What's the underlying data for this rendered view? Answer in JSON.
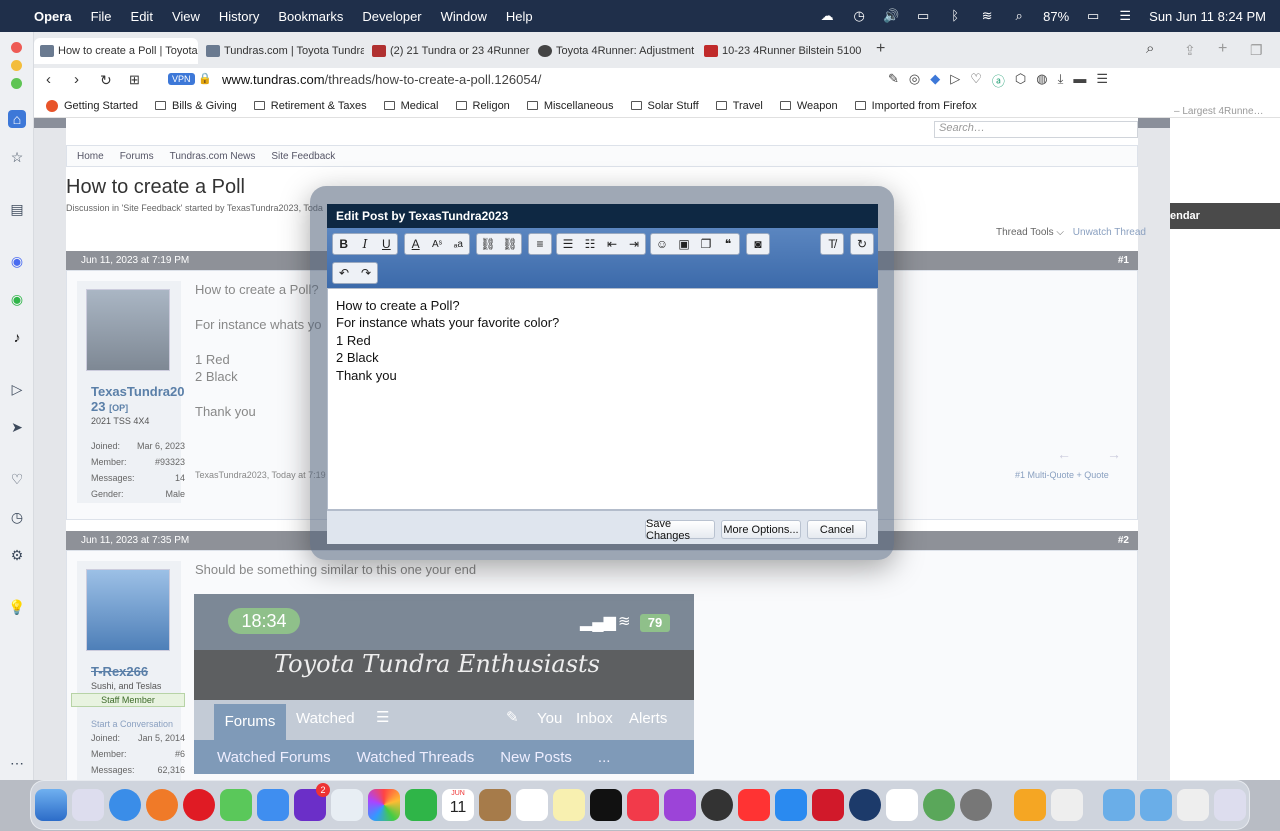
{
  "menubar": {
    "app": "Opera",
    "items": [
      "File",
      "Edit",
      "View",
      "History",
      "Bookmarks",
      "Developer",
      "Window",
      "Help"
    ],
    "battery": "87%",
    "datetime": "Sun Jun 11  8:24 PM"
  },
  "tabs": [
    {
      "label": "How to create a Poll | Toyota Tu",
      "active": true
    },
    {
      "label": "Tundras.com | Toyota Tundra Fo",
      "active": false
    },
    {
      "label": "(2) 21 Tundra or 23 4Runner Vo",
      "active": false
    },
    {
      "label": "Toyota 4Runner: Adjustment - F",
      "active": false
    },
    {
      "label": "10-23 4Runner Bilstein 5100 C",
      "active": false
    }
  ],
  "address": {
    "vpn": "VPN",
    "host": "www.tundras.com",
    "path": "/threads/how-to-create-a-poll.126054/"
  },
  "bookmarks": [
    "Getting Started",
    "Bills & Giving",
    "Retirement & Taxes",
    "Medical",
    "Religon",
    "Miscellaneous",
    "Solar Stuff",
    "Travel",
    "Weapon",
    "Imported from Firefox"
  ],
  "right_pane": {
    "text": "– Largest 4Runne…",
    "bar": "endar"
  },
  "page": {
    "search_placeholder": "Search…",
    "breadcrumbs": [
      "Home",
      "Forums",
      "Tundras.com News",
      "Site Feedback"
    ],
    "title": "How to create a Poll",
    "meta": "Discussion in 'Site Feedback' started by TexasTundra2023, Toda",
    "thread_tools": "Thread Tools",
    "unwatch": "Unwatch Thread"
  },
  "post1": {
    "date": "Jun 11, 2023 at 7:19 PM",
    "num": "#1",
    "user": "TexasTundra20 23",
    "op": "[OP]",
    "user_title": "2021 TSS 4X4",
    "stats": [
      {
        "k": "Joined:",
        "v": "Mar 6, 2023"
      },
      {
        "k": "Member:",
        "v": "#93323"
      },
      {
        "k": "Messages:",
        "v": "14"
      },
      {
        "k": "Gender:",
        "v": "Male"
      }
    ],
    "lines": [
      "How to create a Poll?",
      "For instance whats yo",
      "1 Red",
      "2 Black",
      "Thank you"
    ],
    "footer": "TexasTundra2023, Today at 7:19",
    "footer_right": "#1   Multi-Quote +    Quote"
  },
  "post2": {
    "date": "Jun 11, 2023 at 7:35 PM",
    "num": "#2",
    "user": "T-Rex266",
    "user_title": "Sushi, and Teslas",
    "badge": "Staff Member",
    "start_convo": "Start a Conversation",
    "stats": [
      {
        "k": "Joined:",
        "v": "Jan 5, 2014"
      },
      {
        "k": "Member:",
        "v": "#6"
      },
      {
        "k": "Messages:",
        "v": "62,316"
      }
    ],
    "text": "Should be something similar to this one your end",
    "embed": {
      "time": "18:34",
      "battery": "79",
      "banner": "Toyota Tundra Enthusiasts",
      "nav": [
        "Forums",
        "Watched",
        "You",
        "Inbox",
        "Alerts"
      ],
      "subnav": [
        "Watched Forums",
        "Watched Threads",
        "New Posts",
        "..."
      ]
    }
  },
  "modal": {
    "title": "Edit Post by TexasTundra2023",
    "editor_lines": [
      "How to create a Poll?",
      "",
      "For instance whats your favorite color?",
      "",
      "1 Red",
      "2 Black",
      "",
      "Thank you"
    ],
    "save": "Save Changes",
    "more": "More Options...",
    "cancel": "Cancel"
  },
  "dock": {
    "badge_mail": "2",
    "calendar_month": "JUN",
    "calendar_day": "11"
  }
}
